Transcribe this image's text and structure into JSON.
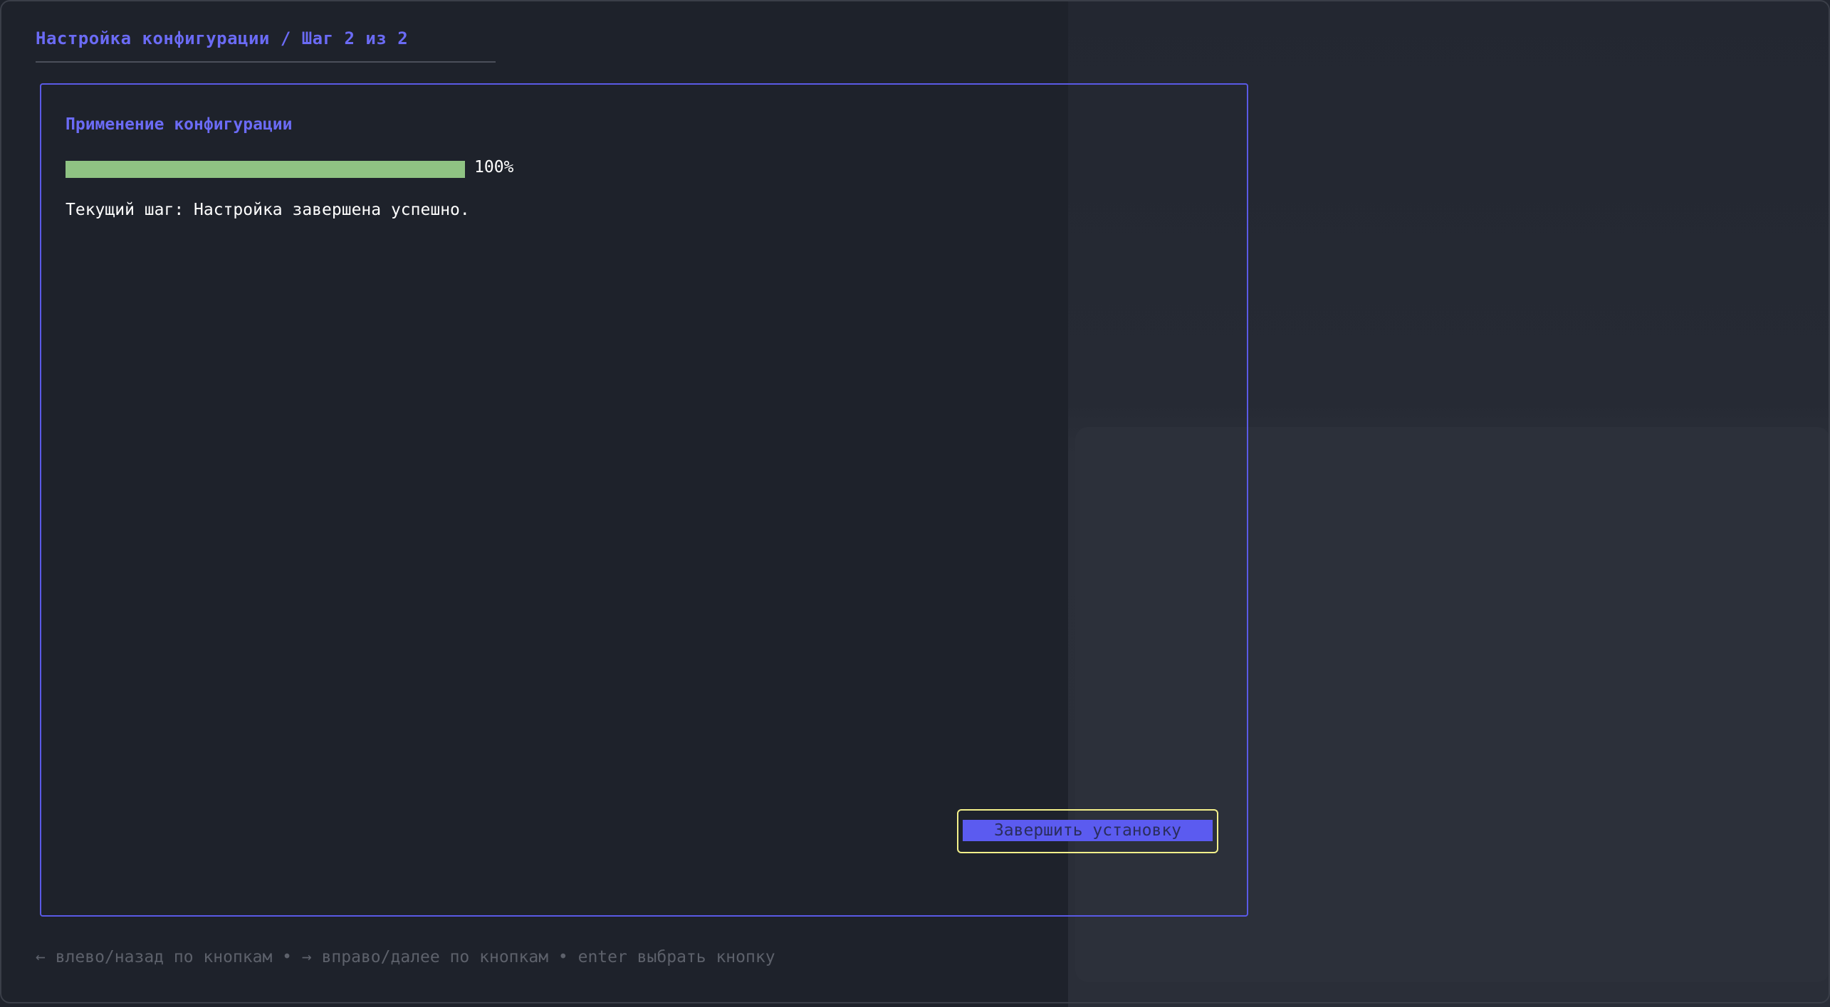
{
  "header": {
    "title": "Настройка конфигурации / Шаг 2 из 2"
  },
  "panel": {
    "title": "Применение конфигурации",
    "progress": {
      "percent": 100,
      "label": "100%"
    },
    "current_step": "Текущий шаг: Настройка завершена успешно."
  },
  "actions": {
    "finish_label": "Завершить установку"
  },
  "footer": {
    "hint": "← влево/назад по кнопкам • → вправо/далее по кнопкам • enter выбрать кнопку"
  },
  "colors": {
    "accent": "#6b6bf5",
    "progress_fill": "#8fc383",
    "focus_outline": "#f3f08a",
    "background": "#1e222b"
  }
}
